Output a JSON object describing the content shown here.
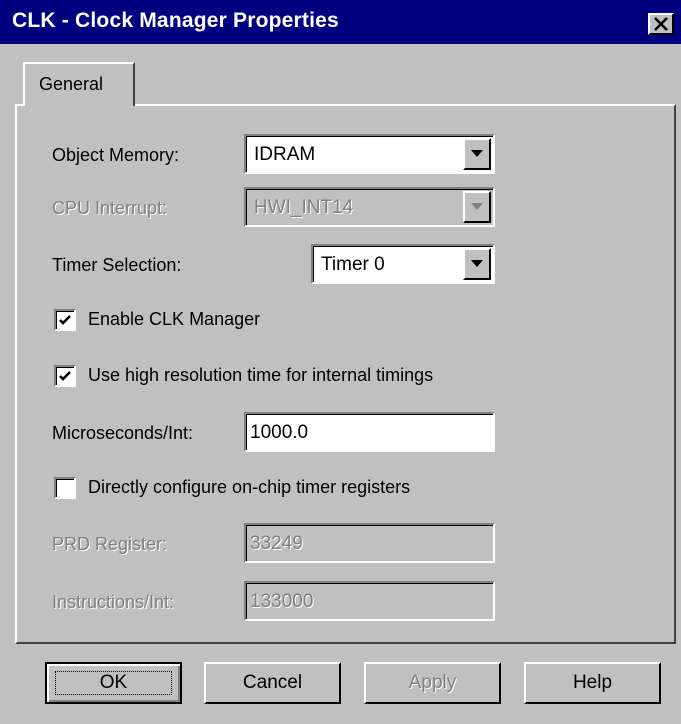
{
  "window": {
    "title": "CLK - Clock Manager Properties"
  },
  "tabs": [
    {
      "label": "General"
    }
  ],
  "form": {
    "object_memory": {
      "label": "Object Memory:",
      "value": "IDRAM"
    },
    "cpu_interrupt": {
      "label": "CPU Interrupt:",
      "value": "HWI_INT14"
    },
    "timer_selection": {
      "label": "Timer Selection:",
      "value": "Timer 0"
    },
    "enable_clk": {
      "label": "Enable CLK Manager",
      "checked": true
    },
    "high_res": {
      "label": "Use high resolution time for internal timings",
      "checked": true
    },
    "microseconds": {
      "label": "Microseconds/Int:",
      "value": "1000.0"
    },
    "direct_config": {
      "label": "Directly configure on-chip timer registers",
      "checked": false
    },
    "prd_register": {
      "label": "PRD Register:",
      "value": "33249"
    },
    "instructions": {
      "label": "Instructions/Int:",
      "value": "133000"
    }
  },
  "buttons": {
    "ok": "OK",
    "cancel": "Cancel",
    "apply": "Apply",
    "help": "Help"
  },
  "icons": {
    "close": "close-icon",
    "dropdown": "chevron-down-icon",
    "check": "check-icon"
  },
  "colors": {
    "titlebar": "#000080",
    "face": "#c0c0c0",
    "disabled_text": "#808080"
  }
}
